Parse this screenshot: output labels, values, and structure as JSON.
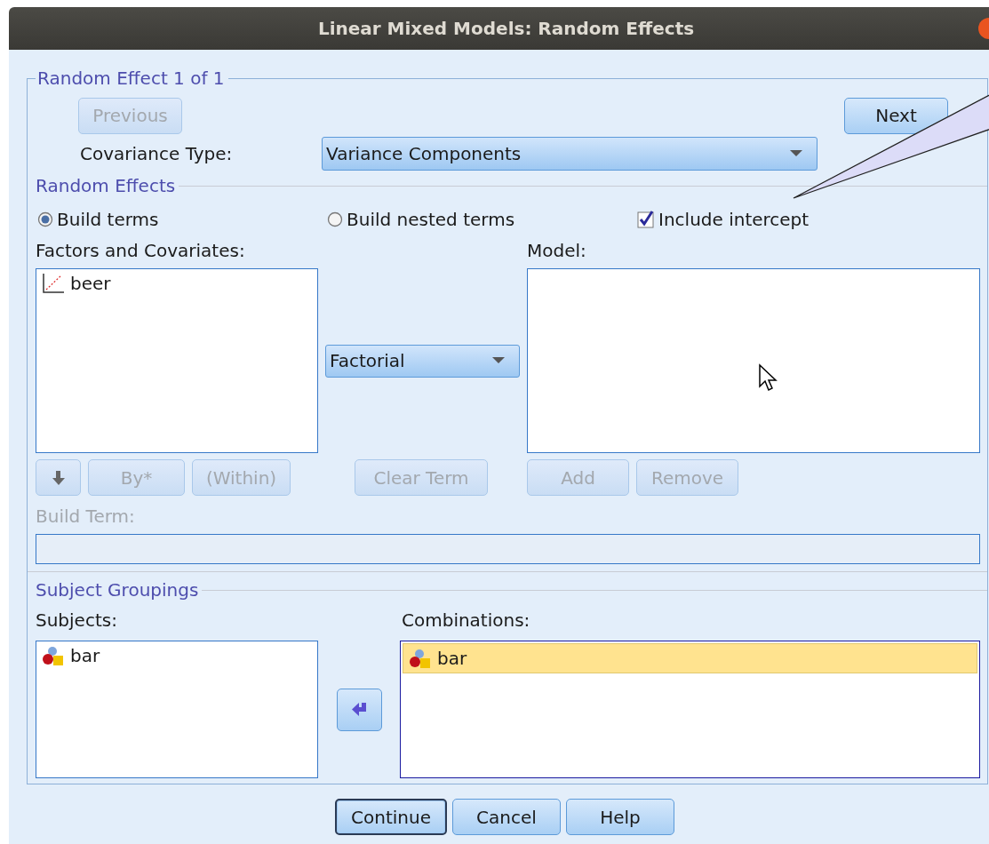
{
  "window": {
    "title": "Linear Mixed Models: Random Effects"
  },
  "random_effect": {
    "legend": "Random Effect 1 of 1",
    "previous": {
      "label": "Previous",
      "disabled": true
    },
    "next": {
      "label": "Next",
      "disabled": false
    },
    "covariance_label": "Covariance Type:",
    "covariance_value": "Variance Components"
  },
  "random_effects": {
    "legend": "Random Effects",
    "options": [
      {
        "kind": "radio",
        "label": "Build terms",
        "selected": true
      },
      {
        "kind": "radio",
        "label": "Build nested terms",
        "selected": false
      },
      {
        "kind": "checkbox",
        "label": "Include intercept",
        "checked": true
      }
    ],
    "factors_label": "Factors and Covariates:",
    "factors": [
      {
        "kind": "scale",
        "label": "beer"
      }
    ],
    "method": "Factorial",
    "model_label": "Model:",
    "term_buttons": [
      {
        "kind": "arrow",
        "disabled": true
      },
      {
        "kind": "text",
        "label": "By*",
        "disabled": true
      },
      {
        "kind": "text",
        "label": "(Within)",
        "disabled": true
      }
    ],
    "clear_term": {
      "label": "Clear Term",
      "disabled": true
    },
    "model_buttons": [
      {
        "label": "Add",
        "disabled": true
      },
      {
        "label": "Remove",
        "disabled": true
      }
    ],
    "build_term": {
      "label": "Build Term:",
      "disabled": true
    }
  },
  "subject_groupings": {
    "legend": "Subject Groupings",
    "subjects_label": "Subjects:",
    "subjects": [
      {
        "kind": "nominal",
        "label": "bar",
        "selected": false
      }
    ],
    "combinations_label": "Combinations:",
    "combinations": [
      {
        "kind": "nominal",
        "label": "bar",
        "selected": true
      }
    ]
  },
  "buttons": [
    {
      "label": "Continue",
      "focused": true
    },
    {
      "label": "Cancel",
      "focused": false
    },
    {
      "label": "Help",
      "focused": false
    }
  ]
}
